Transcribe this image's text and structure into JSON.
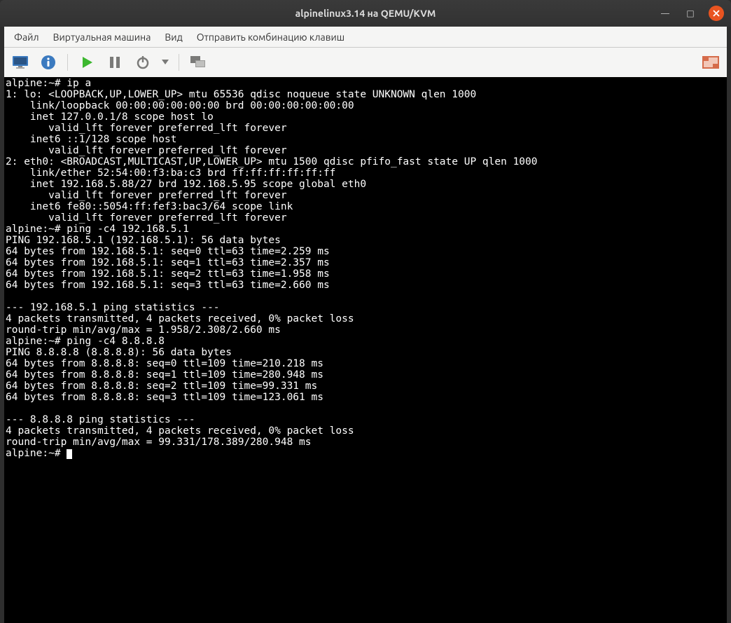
{
  "window": {
    "title": "alpinelinux3.14 на QEMU/KVM"
  },
  "menubar": {
    "file": "Файл",
    "vm": "Виртуальная машина",
    "view": "Вид",
    "sendkey": "Отправить комбинацию клавиш"
  },
  "icons": {
    "console": "console-icon",
    "info": "info-icon",
    "play": "play-icon",
    "pause": "pause-icon",
    "power": "power-icon",
    "dropdown": "dropdown-icon",
    "snapshots": "snapshots-icon",
    "fullscreen": "fullscreen-icon",
    "minimize": "—",
    "maximize": "□"
  },
  "terminal": {
    "l01": "alpine:~# ip a",
    "l02": "1: lo: <LOOPBACK,UP,LOWER_UP> mtu 65536 qdisc noqueue state UNKNOWN qlen 1000",
    "l03": "    link/loopback 00:00:00:00:00:00 brd 00:00:00:00:00:00",
    "l04": "    inet 127.0.0.1/8 scope host lo",
    "l05": "       valid_lft forever preferred_lft forever",
    "l06": "    inet6 ::1/128 scope host",
    "l07": "       valid_lft forever preferred_lft forever",
    "l08": "2: eth0: <BROADCAST,MULTICAST,UP,LOWER_UP> mtu 1500 qdisc pfifo_fast state UP qlen 1000",
    "l09": "    link/ether 52:54:00:f3:ba:c3 brd ff:ff:ff:ff:ff:ff",
    "l10": "    inet 192.168.5.88/27 brd 192.168.5.95 scope global eth0",
    "l11": "       valid_lft forever preferred_lft forever",
    "l12": "    inet6 fe80::5054:ff:fef3:bac3/64 scope link",
    "l13": "       valid_lft forever preferred_lft forever",
    "l14": "alpine:~# ping -c4 192.168.5.1",
    "l15": "PING 192.168.5.1 (192.168.5.1): 56 data bytes",
    "l16": "64 bytes from 192.168.5.1: seq=0 ttl=63 time=2.259 ms",
    "l17": "64 bytes from 192.168.5.1: seq=1 ttl=63 time=2.357 ms",
    "l18": "64 bytes from 192.168.5.1: seq=2 ttl=63 time=1.958 ms",
    "l19": "64 bytes from 192.168.5.1: seq=3 ttl=63 time=2.660 ms",
    "l20": "",
    "l21": "--- 192.168.5.1 ping statistics ---",
    "l22": "4 packets transmitted, 4 packets received, 0% packet loss",
    "l23": "round-trip min/avg/max = 1.958/2.308/2.660 ms",
    "l24": "alpine:~# ping -c4 8.8.8.8",
    "l25": "PING 8.8.8.8 (8.8.8.8): 56 data bytes",
    "l26": "64 bytes from 8.8.8.8: seq=0 ttl=109 time=210.218 ms",
    "l27": "64 bytes from 8.8.8.8: seq=1 ttl=109 time=280.948 ms",
    "l28": "64 bytes from 8.8.8.8: seq=2 ttl=109 time=99.331 ms",
    "l29": "64 bytes from 8.8.8.8: seq=3 ttl=109 time=123.061 ms",
    "l30": "",
    "l31": "--- 8.8.8.8 ping statistics ---",
    "l32": "4 packets transmitted, 4 packets received, 0% packet loss",
    "l33": "round-trip min/avg/max = 99.331/178.389/280.948 ms",
    "l34": "alpine:~# "
  }
}
